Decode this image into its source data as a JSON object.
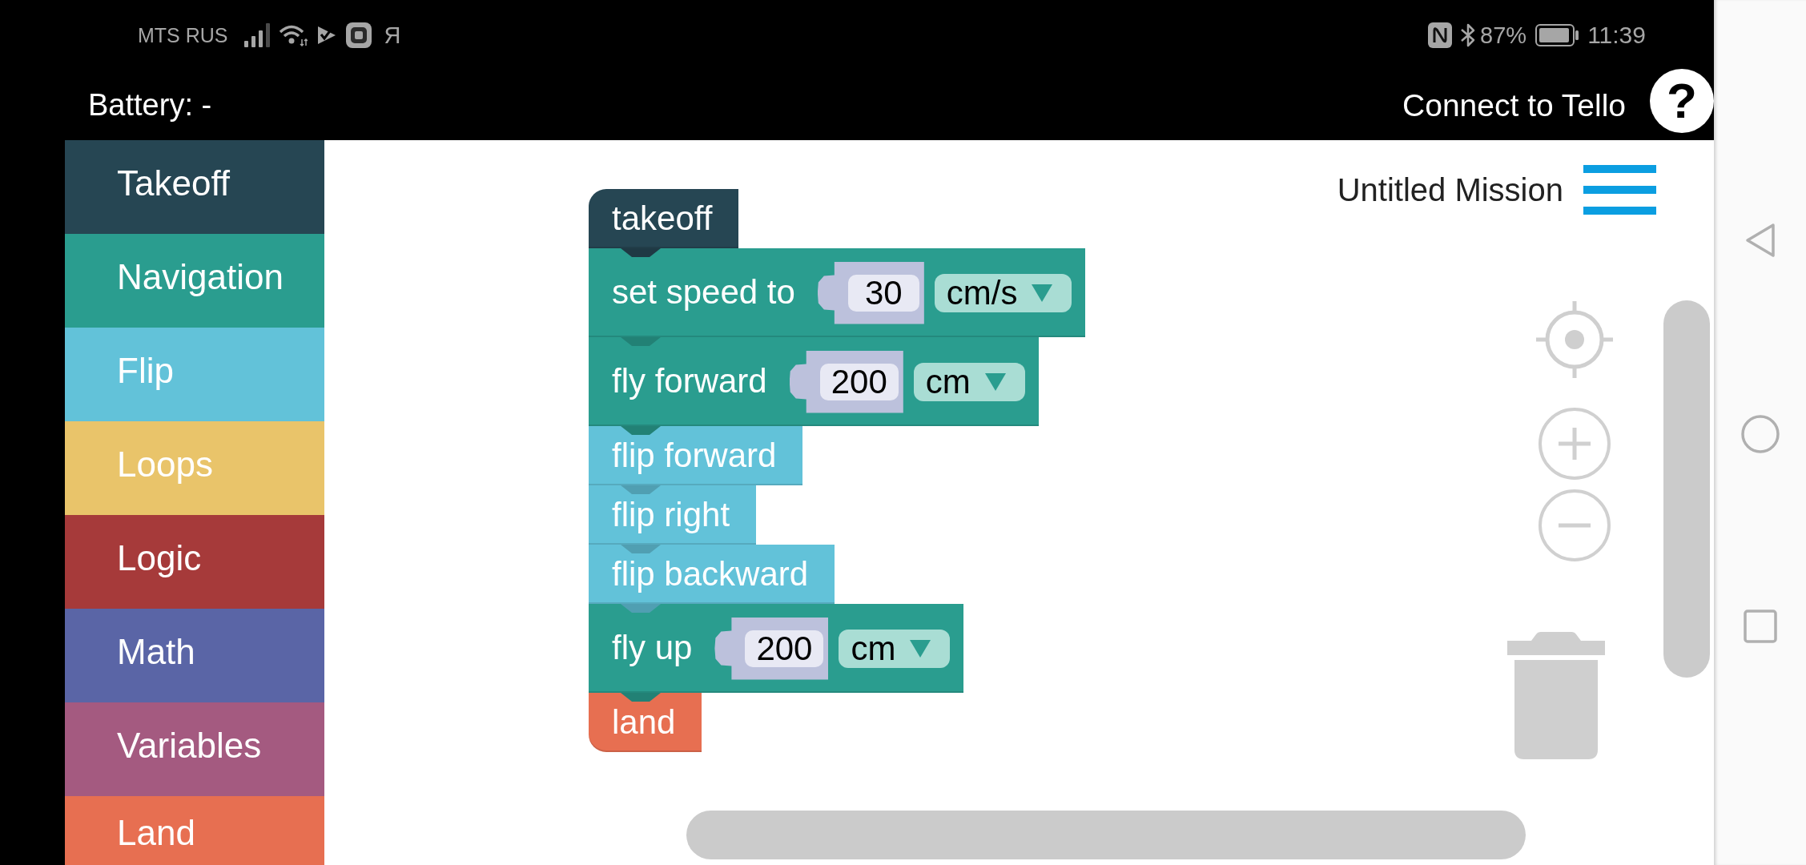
{
  "status_bar": {
    "carrier": "MTS RUS",
    "notification_glyph": "Я",
    "battery": "87%",
    "time": "11:39"
  },
  "header": {
    "battery_label": "Battery: -",
    "connect_button": "Connect to Tello",
    "help_button": "?"
  },
  "sidebar": {
    "items": [
      {
        "label": "Takeoff",
        "color": "#264653"
      },
      {
        "label": "Navigation",
        "color": "#2a9d8f"
      },
      {
        "label": "Flip",
        "color": "#62c2d9"
      },
      {
        "label": "Loops",
        "color": "#e9c46a"
      },
      {
        "label": "Logic",
        "color": "#a63a3a"
      },
      {
        "label": "Math",
        "color": "#5a65a6"
      },
      {
        "label": "Variables",
        "color": "#a45a80"
      },
      {
        "label": "Land",
        "color": "#e76f51"
      }
    ]
  },
  "workspace": {
    "mission_title": "Untitled Mission",
    "blocks": [
      {
        "kind": "start",
        "label": "takeoff",
        "color": "#264653"
      },
      {
        "kind": "input",
        "label": "set speed to",
        "value": "30",
        "unit": "cm/s",
        "color": "#2a9d8f"
      },
      {
        "kind": "input",
        "label": "fly forward",
        "value": "200",
        "unit": "cm",
        "color": "#2a9d8f"
      },
      {
        "kind": "simple",
        "label": "flip forward",
        "color": "#62c2d9"
      },
      {
        "kind": "simple",
        "label": "flip right",
        "color": "#62c2d9"
      },
      {
        "kind": "simple",
        "label": "flip backward",
        "color": "#62c2d9"
      },
      {
        "kind": "input",
        "label": "fly up",
        "value": "200",
        "unit": "cm",
        "color": "#2a9d8f"
      },
      {
        "kind": "end",
        "label": "land",
        "color": "#e76f51"
      }
    ]
  }
}
